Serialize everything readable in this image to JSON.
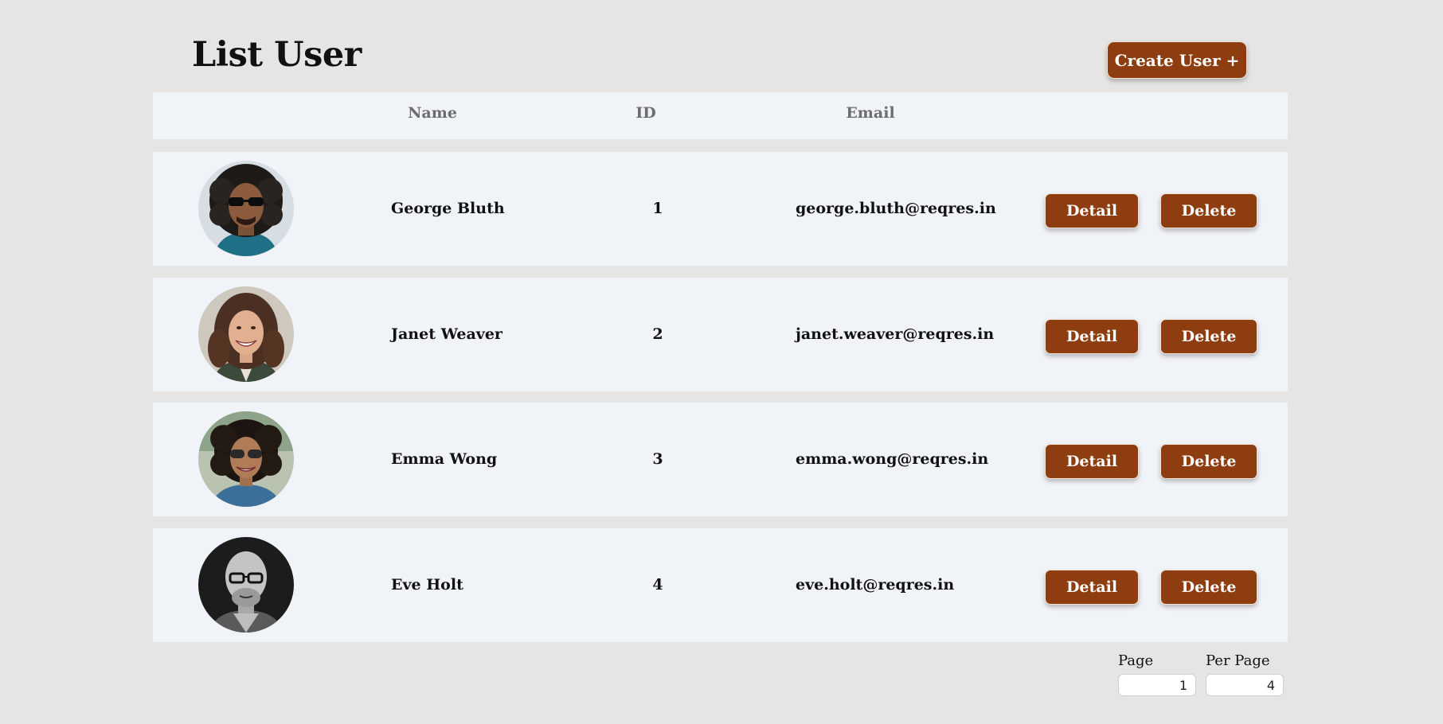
{
  "page": {
    "title": "List User",
    "create_button_label": "Create User +"
  },
  "table": {
    "headers": {
      "name": "Name",
      "id": "ID",
      "email": "Email"
    },
    "detail_label": "Detail",
    "delete_label": "Delete",
    "rows": [
      {
        "name": "George Bluth",
        "id": "1",
        "email": "george.bluth@reqres.in",
        "avatar": "portrait-curly-hair-sunglasses"
      },
      {
        "name": "Janet Weaver",
        "id": "2",
        "email": "janet.weaver@reqres.in",
        "avatar": "portrait-smiling-woman"
      },
      {
        "name": "Emma Wong",
        "id": "3",
        "email": "emma.wong@reqres.in",
        "avatar": "portrait-woman-sunglasses"
      },
      {
        "name": "Eve Holt",
        "id": "4",
        "email": "eve.holt@reqres.in",
        "avatar": "portrait-bald-man-glasses-bw"
      }
    ]
  },
  "pagination": {
    "page_label": "Page",
    "page_value": "1",
    "per_page_label": "Per Page",
    "per_page_value": "4"
  },
  "colors": {
    "background": "#e6e5e3",
    "row_background": "#f0f3f8",
    "button": "#8d3d0f",
    "button_text": "#ffffff"
  }
}
